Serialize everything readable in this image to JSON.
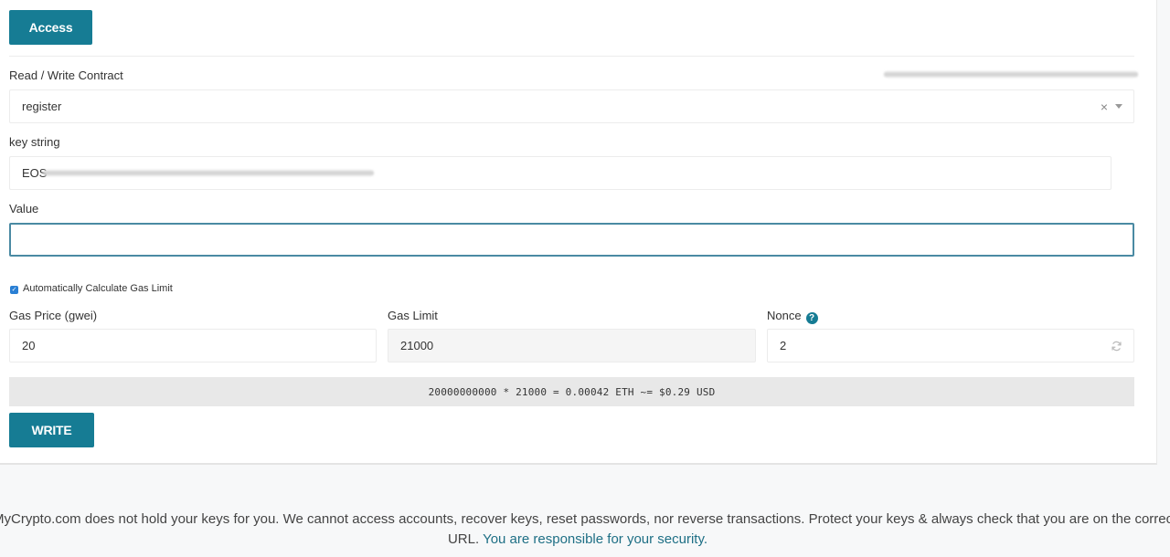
{
  "access_button": {
    "label": "Access"
  },
  "contract": {
    "label": "Read / Write Contract",
    "selected_function": "register",
    "clear_icon": "×"
  },
  "inputs": {
    "key_string": {
      "label": "key string",
      "value": "EOS"
    },
    "value": {
      "label": "Value",
      "value": "",
      "placeholder": ""
    }
  },
  "gas": {
    "auto_calc_label": "Automatically Calculate Gas Limit",
    "auto_calc_checked": true,
    "price": {
      "label": "Gas Price (gwei)",
      "value": "20"
    },
    "limit": {
      "label": "Gas Limit",
      "value": "21000"
    },
    "nonce": {
      "label": "Nonce",
      "value": "2",
      "help_icon": "?"
    }
  },
  "fee_summary": "20000000000 * 21000 = 0.00042 ETH ~= $0.29 USD",
  "write_button": {
    "label": "WRITE"
  },
  "footer": {
    "text": "MyCrypto.com does not hold your keys for you. We cannot access accounts, recover keys, reset passwords, nor reverse transactions. Protect your keys & always check that you are on the correct",
    "text2": "URL.",
    "link": "You are responsible for your security."
  }
}
